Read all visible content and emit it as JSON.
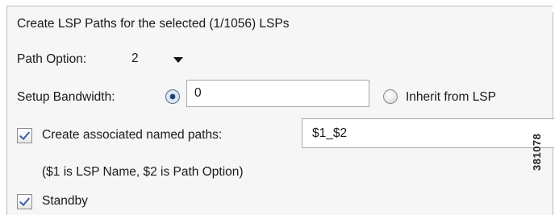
{
  "title": "Create LSP Paths for the selected (1/1056) LSPs",
  "path_option": {
    "label": "Path Option:",
    "selected": "2"
  },
  "setup_bandwidth": {
    "label": "Setup Bandwidth:",
    "value": "0",
    "custom_selected": true,
    "inherit_label": "Inherit from LSP",
    "inherit_selected": false
  },
  "named_paths": {
    "checked": true,
    "label": "Create associated named paths:",
    "value": "$1_$2",
    "hint": "($1 is LSP Name, $2 is Path Option)"
  },
  "standby": {
    "checked": true,
    "label": "Standby"
  },
  "figure_id": "381078",
  "colors": {
    "panel_bg": "#f6f6f6",
    "check_mark": "#3a5fae",
    "radio_selected": "#1d3f73"
  }
}
